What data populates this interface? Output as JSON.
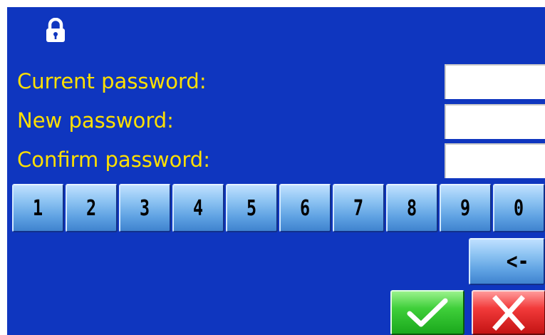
{
  "icons": {
    "lock": "lock-icon",
    "confirm": "check-icon",
    "cancel": "close-icon"
  },
  "form": {
    "current_password_label": "Current password:",
    "new_password_label": "New password:",
    "confirm_password_label": "Confirm password:",
    "current_password_value": "",
    "new_password_value": "",
    "confirm_password_value": ""
  },
  "keypad": {
    "keys": [
      "1",
      "2",
      "3",
      "4",
      "5",
      "6",
      "7",
      "8",
      "9",
      "0"
    ],
    "backspace_label": "<-"
  },
  "colors": {
    "background": "#0f36bf",
    "label": "#ffe000",
    "confirm": "#2cc02a",
    "cancel": "#e42626"
  }
}
